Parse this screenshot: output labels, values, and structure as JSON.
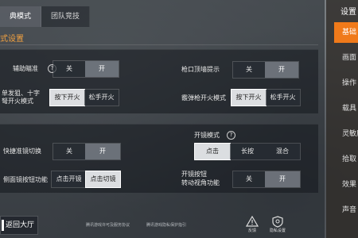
{
  "tabs": [
    {
      "label": "典模式",
      "active": true
    },
    {
      "label": "团队竞技",
      "active": false
    }
  ],
  "section_title": "式设置",
  "rows": {
    "assist_aim": {
      "label": "辅助瞄准",
      "options": [
        "关",
        "开"
      ],
      "selected": "开"
    },
    "muzzle_hint": {
      "label": "枪口顶墙提示",
      "options": [
        "关",
        "开"
      ],
      "selected": "开"
    },
    "single_fire": {
      "label_line1": "单发狙、十字",
      "label_line2": "弩开火模式",
      "options": [
        "按下开火",
        "松手开火"
      ],
      "selected": "按下开火"
    },
    "shotgun_fire": {
      "label": "霰弹枪开火模式",
      "options": [
        "按下开火",
        "松手开火"
      ],
      "selected": "按下开火"
    },
    "scope_mode": {
      "label": "开镜模式",
      "options": [
        "点击",
        "长按",
        "混合"
      ],
      "selected": "点击"
    },
    "quick_scope": {
      "label": "快捷准镜切换",
      "options": [
        "关",
        "开"
      ],
      "selected": "开"
    },
    "side_button": {
      "label": "侧面镜按钮功能",
      "options": [
        "点击开镜",
        "点击切镜"
      ],
      "selected": "点击切镜"
    },
    "scope_view": {
      "label_line1": "开镜按钮",
      "label_line2": "转动视角功能",
      "options": [
        "关",
        "开"
      ],
      "selected": "开"
    }
  },
  "sidebar": {
    "title": "设置",
    "items": [
      {
        "label": "基础",
        "active": true
      },
      {
        "label": "画面",
        "active": false
      },
      {
        "label": "操作",
        "active": false
      },
      {
        "label": "载具",
        "active": false
      },
      {
        "label": "灵敏度",
        "active": false
      },
      {
        "label": "拾取",
        "active": false
      },
      {
        "label": "效果",
        "active": false
      },
      {
        "label": "声音",
        "active": false
      }
    ]
  },
  "back_label": "返回大厅",
  "footer": {
    "left": "腾讯游戏许可及服务协议",
    "right": "腾讯游戏隐私保护指引"
  },
  "bottom_icons": [
    {
      "icon": "warning-icon",
      "caption": "反馈"
    },
    {
      "icon": "shield-icon",
      "caption": "隐私设置"
    }
  ],
  "question_mark": "?"
}
